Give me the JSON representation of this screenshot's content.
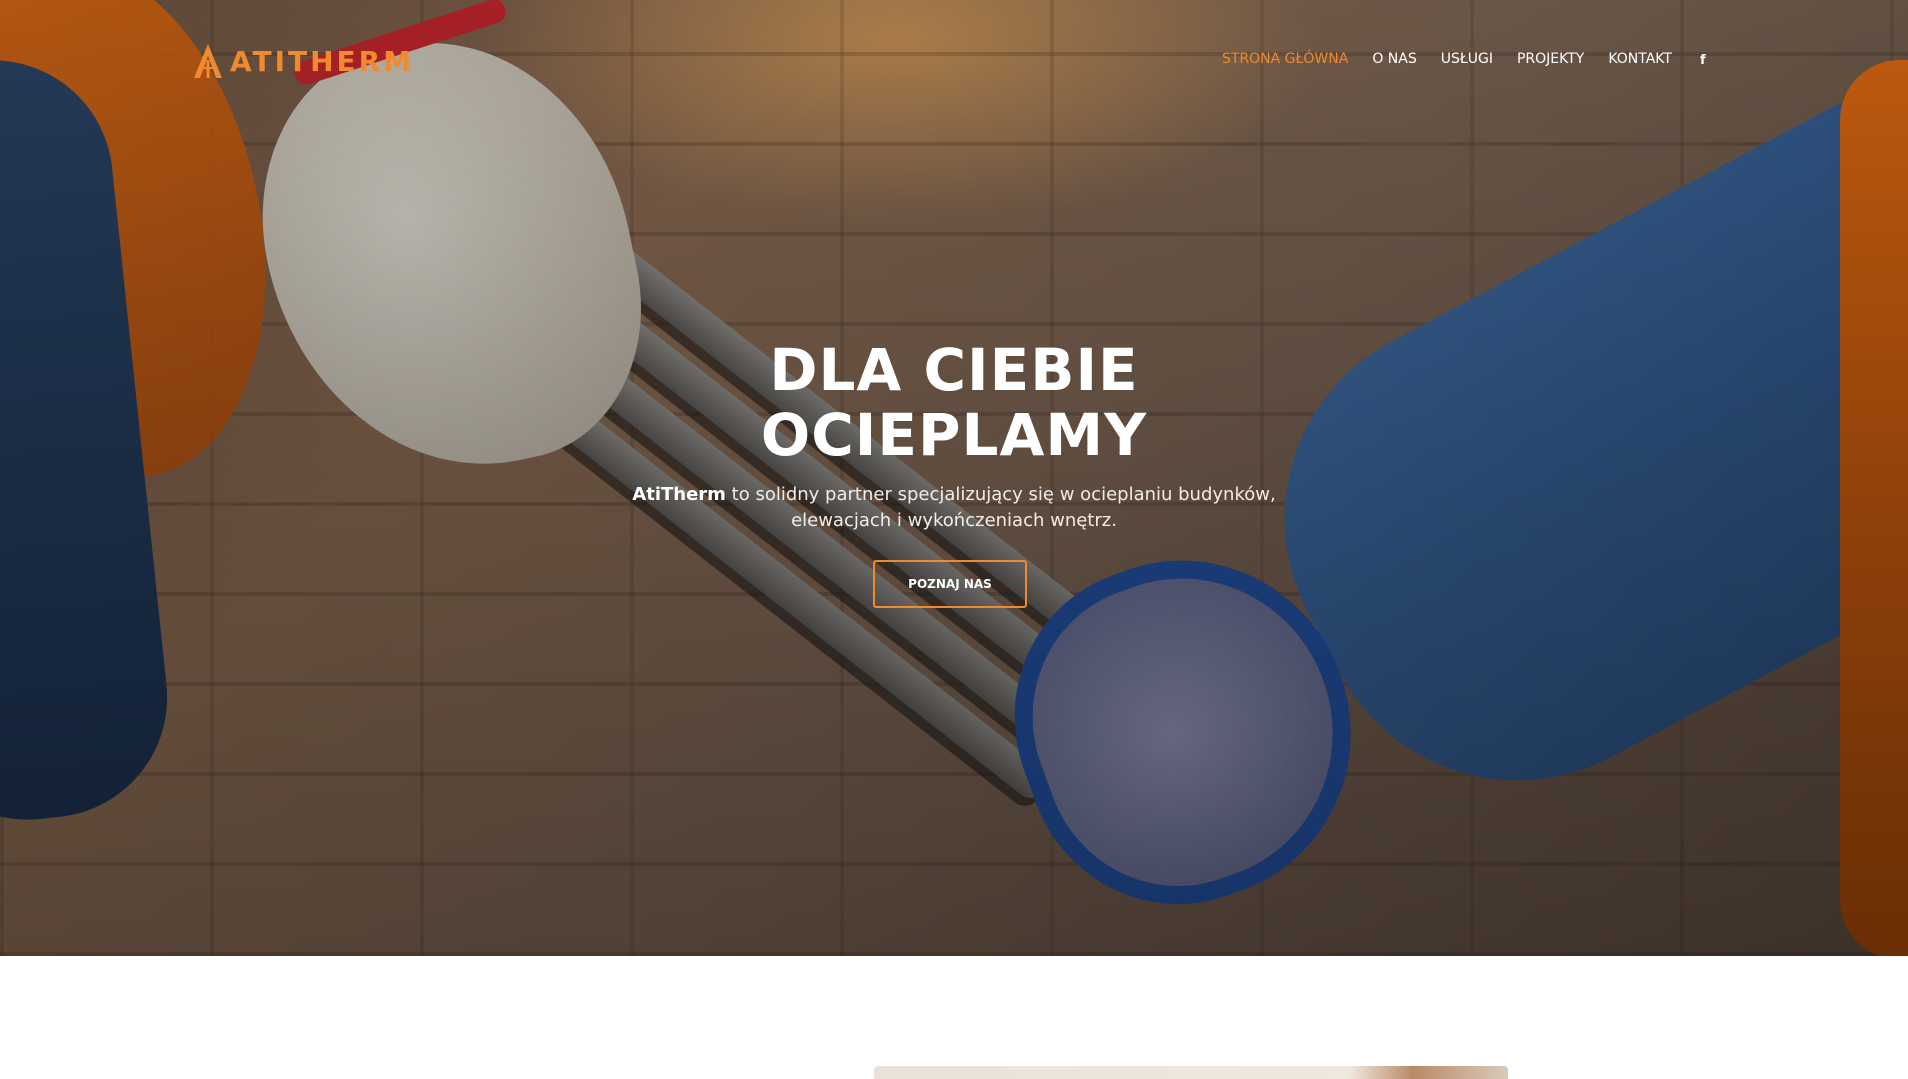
{
  "brand": {
    "logo_text": "ATITHERM",
    "accent_color": "#f08a2e"
  },
  "nav": {
    "items": [
      {
        "label": "STRONA GŁÓWNA",
        "active": true
      },
      {
        "label": "O NAS",
        "active": false
      },
      {
        "label": "USŁUGI",
        "active": false
      },
      {
        "label": "PROJEKTY",
        "active": false
      },
      {
        "label": "KONTAKT",
        "active": false
      }
    ],
    "social_icon": "facebook-icon",
    "social_glyph": "f"
  },
  "hero": {
    "title_line1": "DLA CIEBIE",
    "title_line2": "OCIEPLAMY",
    "subtitle_brand": "AtiTherm",
    "subtitle_rest": " to solidny partner specjalizujący się w ocieplaniu budynków,",
    "subtitle_line2": "elewacjach i wykończeniach wnętrz.",
    "cta_label": "POZNAJ NAS"
  }
}
